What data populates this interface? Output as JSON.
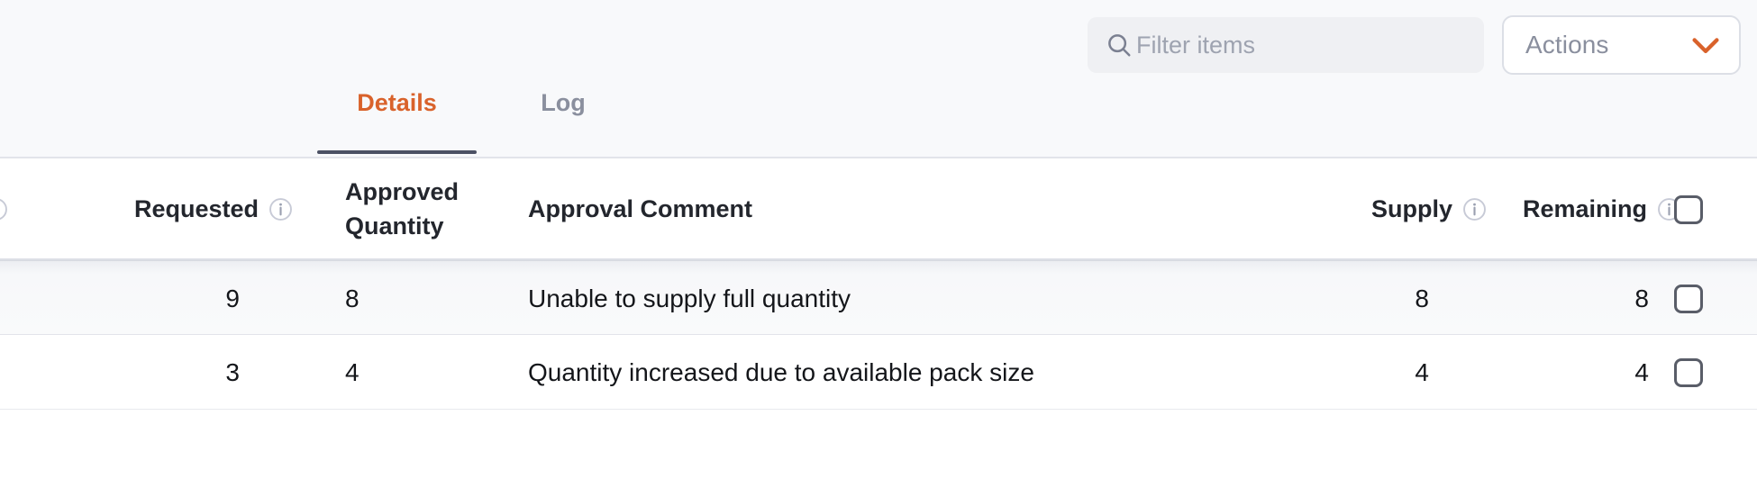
{
  "toolbar": {
    "filter": {
      "placeholder": "Filter items",
      "value": "",
      "icon": "search-icon"
    },
    "actions": {
      "label": "Actions",
      "icon": "chevron-down-icon"
    }
  },
  "tabs": {
    "items": [
      {
        "label": "Details",
        "active": true
      },
      {
        "label": "Log",
        "active": false
      }
    ],
    "active_label": "Details",
    "inactive_label": "Log"
  },
  "table": {
    "columns": [
      {
        "key": "requested",
        "label": "Requested",
        "has_info_icon": true,
        "align": "right"
      },
      {
        "key": "approved_quantity",
        "label_line1": "Approved",
        "label_line2": "Quantity",
        "has_info_icon": false,
        "align": "left"
      },
      {
        "key": "approval_comment",
        "label": "Approval Comment",
        "has_info_icon": false,
        "align": "left"
      },
      {
        "key": "supply",
        "label": "Supply",
        "has_info_icon": true,
        "align": "right"
      },
      {
        "key": "remaining",
        "label": "Remaining",
        "has_info_icon": true,
        "align": "right"
      },
      {
        "key": "select",
        "label": "",
        "has_info_icon": false,
        "align": "left"
      }
    ],
    "header": {
      "requested": "Requested",
      "approved_line1": "Approved",
      "approved_line2": "Quantity",
      "approval_comment": "Approval Comment",
      "supply": "Supply",
      "remaining": "Remaining"
    },
    "rows": [
      {
        "requested": "9",
        "approved_quantity": "8",
        "approval_comment": "Unable to supply full quantity",
        "supply": "8",
        "remaining": "8",
        "selected": false,
        "highlighted": true
      },
      {
        "requested": "3",
        "approved_quantity": "4",
        "approval_comment": "Quantity increased due to available pack size",
        "supply": "4",
        "remaining": "4",
        "selected": false,
        "highlighted": false
      }
    ]
  },
  "colors": {
    "accent_orange": "#d9622b",
    "tab_underline": "#4c5164",
    "header_bg": "#f8f9fb",
    "row_highlight": "#f2f3f6",
    "text_primary": "#14161a",
    "text_muted": "#8a8f9e",
    "border": "#dcdfe6"
  }
}
